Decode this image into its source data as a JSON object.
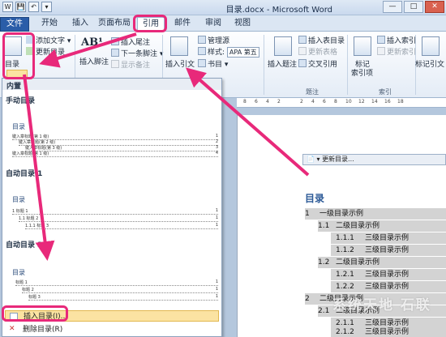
{
  "window": {
    "title": "目录.docx - Microsoft Word",
    "qat_icons": [
      "W",
      "💾",
      "↶",
      "▾"
    ],
    "buttons": [
      "—",
      "□",
      "✕"
    ]
  },
  "tabs": [
    "文件",
    "开始",
    "插入",
    "页面布局",
    "引用",
    "邮件",
    "审阅",
    "视图"
  ],
  "ribbon": {
    "toc_group": {
      "toc_button": "目录",
      "add_text": "添加文字 ▾",
      "update_toc": "更新目录"
    },
    "footnote_group": {
      "insert_footnote": "AB¹",
      "insert_footnote_label": "插入脚注",
      "insert_endnote": "插入尾注",
      "next_footnote": "下一条脚注 ▾",
      "show_notes": "显示备注"
    },
    "citation_group": {
      "insert_citation": "插入引文",
      "manage_sources": "管理源",
      "style_label": "样式:",
      "style_value": "APA 第五",
      "bibliography": "书目 ▾"
    },
    "caption_group": {
      "insert_caption": "插入题注",
      "insert_table_of_figures": "插入表目录",
      "update_table": "更新表格",
      "cross_reference": "交叉引用",
      "label": "题注"
    },
    "index_group": {
      "mark_entry": "标记",
      "mark_entry2": "索引项",
      "insert_index": "插入索引",
      "update_index": "更新索引",
      "label": "索引"
    },
    "mark_citation": "标记引文"
  },
  "ruler_marks": [
    "8",
    "6",
    "4",
    "2",
    "2",
    "4",
    "6",
    "8",
    "10",
    "12",
    "14",
    "16",
    "18"
  ],
  "dropdown": {
    "header": "内置",
    "manual_toc": "手动目录",
    "manual_title": "目录",
    "manual_lines": [
      {
        "text": "键入章标题(第 1 级)",
        "page": "1"
      },
      {
        "text": "键入章标题(第 2 级)",
        "page": "2"
      },
      {
        "text": "键入章标题(第 3 级)",
        "page": "3"
      },
      {
        "text": "键入章标题(第 1 级)",
        "page": "4"
      }
    ],
    "auto1": "自动目录 1",
    "auto1_title": "目录",
    "auto1_lines": [
      {
        "text": "1      标题 1",
        "page": "1"
      },
      {
        "text": "1.1         标题 2",
        "page": "1"
      },
      {
        "text": "1.1.1        标题 3",
        "page": "1"
      }
    ],
    "auto2": "自动目录 2",
    "auto2_title": "目录",
    "auto2_lines": [
      {
        "text": "标题 1",
        "page": "1"
      },
      {
        "text": "标题 2",
        "page": "1"
      },
      {
        "text": "标题 3",
        "page": "1"
      }
    ],
    "insert_toc": "插入目录(I)...",
    "delete_toc": "删除目录(R)"
  },
  "document": {
    "content_control": "📄 ▾  更新目录...",
    "heading": "目录",
    "entries": [
      {
        "num": "1",
        "text": "一级目录示例"
      },
      {
        "num": "1.1",
        "text": "二级目录示例"
      },
      {
        "num": "1.1.1",
        "text": "三级目录示例"
      },
      {
        "num": "1.1.2",
        "text": "三级目录示例"
      },
      {
        "num": "1.2",
        "text": "二级目录示例"
      },
      {
        "num": "1.2.1",
        "text": "三级目录示例"
      },
      {
        "num": "1.2.2",
        "text": "三级目录示例"
      },
      {
        "num": "2",
        "text": "二级目录示例"
      },
      {
        "num": "2.1",
        "text": "二级目录示例"
      },
      {
        "num": "2.1.1",
        "text": "三级目录示例"
      },
      {
        "num": "2.1.2",
        "text": "三级目录示例"
      }
    ],
    "watermark": "系统天地 石联"
  },
  "colors": {
    "highlight": "#e8297a",
    "file_tab": "#2a5da8",
    "menu_hover": "#fbe3a2"
  }
}
